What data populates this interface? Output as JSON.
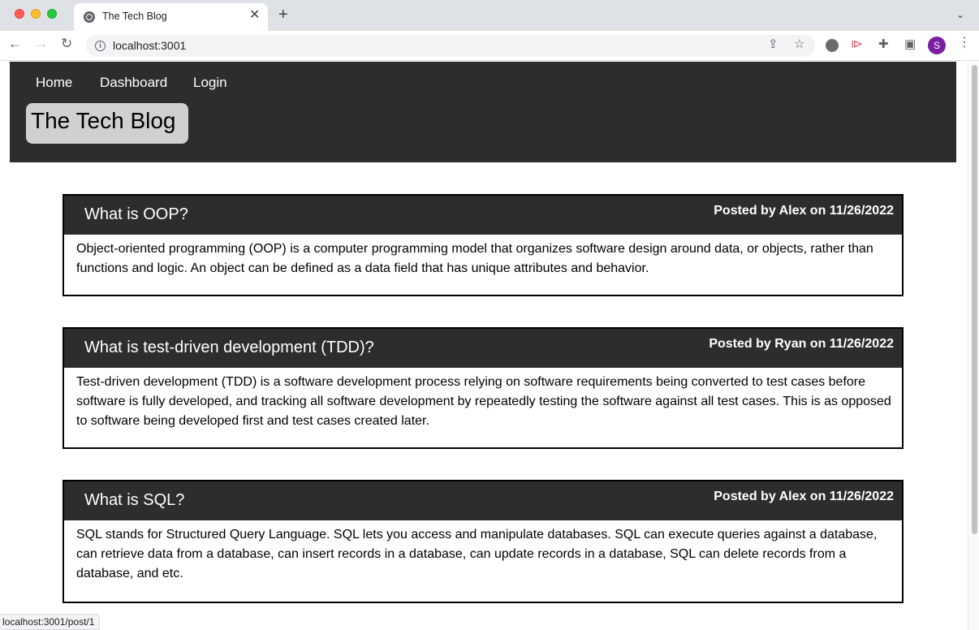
{
  "browser": {
    "tab_title": "The Tech Blog",
    "tab_close": "✕",
    "new_tab": "+",
    "tabs_dropdown": "⌄",
    "url": "localhost:3001",
    "profile_initial": "S",
    "status_url": "localhost:3001/post/1",
    "icons": {
      "back": "←",
      "forward": "→",
      "reload": "↻",
      "info": "i",
      "share": "⇪",
      "star": "☆",
      "extension_puzzle": "✚",
      "side_panel": "▣",
      "menu": "⋮",
      "video_ext": "⧐"
    }
  },
  "site": {
    "nav": {
      "home": "Home",
      "dashboard": "Dashboard",
      "login": "Login"
    },
    "title": "The Tech Blog"
  },
  "posts": [
    {
      "title": "What is OOP?",
      "meta": "Posted by Alex on 11/26/2022",
      "body": "Object-oriented programming (OOP) is a computer programming model that organizes software design around data, or objects, rather than functions and logic. An object can be defined as a data field that has unique attributes and behavior."
    },
    {
      "title": "What is test-driven development (TDD)?",
      "meta": "Posted by Ryan on 11/26/2022",
      "body": "Test-driven development (TDD) is a software development process relying on software requirements being converted to test cases before software is fully developed, and tracking all software development by repeatedly testing the software against all test cases. This is as opposed to software being developed first and test cases created later."
    },
    {
      "title": "What is SQL?",
      "meta": "Posted by Alex on 11/26/2022",
      "body": "SQL stands for Structured Query Language. SQL lets you access and manipulate databases. SQL can execute queries against a database, can retrieve data from a database, can insert records in a database, can update records in a database, SQL can delete records from a database, and etc."
    }
  ]
}
